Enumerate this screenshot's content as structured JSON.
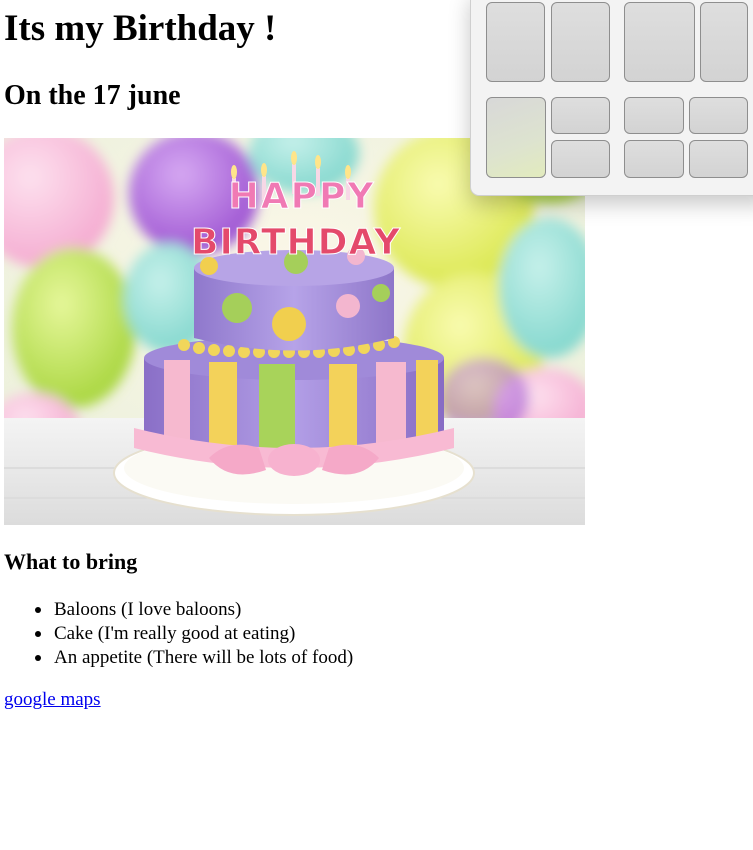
{
  "heading": "Its my Birthday !",
  "subheading": "On the 17 june",
  "hero_image": {
    "alt": "Birthday cake",
    "topper_line1": "HAPPY",
    "topper_line2": "BIRTHDAY"
  },
  "bring_heading": "What to bring",
  "bring_items": [
    "Baloons (I love baloons)",
    "Cake (I'm really good at eating)",
    "An appetite (There will be lots of food)"
  ],
  "map_link": "google maps",
  "colors": {
    "link": "#0000ee",
    "snap_panel": "#f3f3f3",
    "snap_zone": "#d8d8d8"
  }
}
